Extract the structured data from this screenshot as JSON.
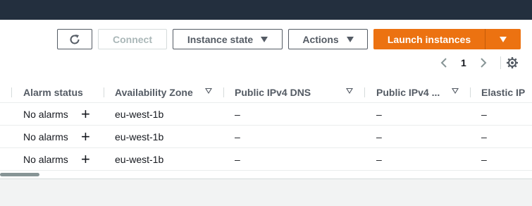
{
  "toolbar": {
    "refresh_icon": "refresh-icon",
    "connect_label": "Connect",
    "instance_state_label": "Instance state",
    "actions_label": "Actions",
    "launch_label": "Launch instances"
  },
  "pagination": {
    "current_page": "1"
  },
  "columns": [
    {
      "label": "Alarm status"
    },
    {
      "label": "Availability Zone"
    },
    {
      "label": "Public IPv4 DNS"
    },
    {
      "label": "Public IPv4 ..."
    },
    {
      "label": "Elastic IP"
    }
  ],
  "rows": [
    {
      "alarm": "No alarms",
      "zone": "eu-west-1b",
      "dns": "–",
      "ipv4": "–",
      "elastic": "–"
    },
    {
      "alarm": "No alarms",
      "zone": "eu-west-1b",
      "dns": "–",
      "ipv4": "–",
      "elastic": "–"
    },
    {
      "alarm": "No alarms",
      "zone": "eu-west-1b",
      "dns": "–",
      "ipv4": "–",
      "elastic": "–"
    }
  ],
  "colors": {
    "accent": "#ec7211",
    "topbar": "#232f3e"
  }
}
